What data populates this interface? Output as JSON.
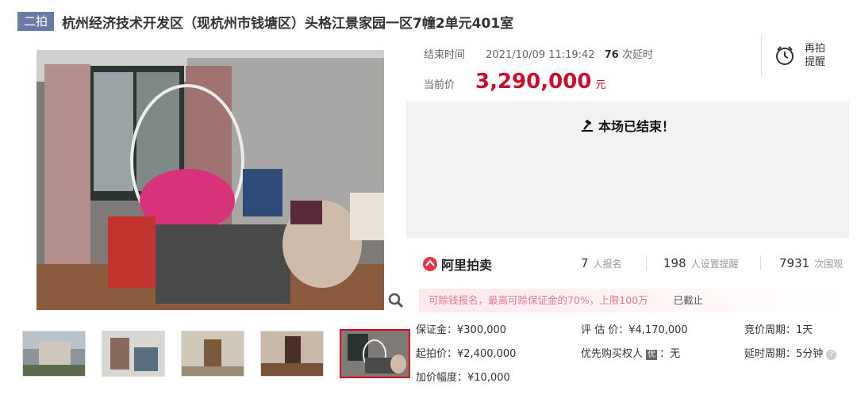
{
  "header": {
    "tag": "二拍",
    "title": "杭州经济技术开发区（现杭州市钱塘区）头格江景家园一区7幢2单元401室"
  },
  "auction": {
    "end_label": "结束时间",
    "end_time": "2021/10/09 11:19:42",
    "extend_count": "76",
    "extend_label": "次延时",
    "price_label": "当前价",
    "price": "3,290,000",
    "currency": "元",
    "remind": {
      "line1": "再拍",
      "line2": "提醒"
    },
    "ended_text": "本场已结束！"
  },
  "stats": {
    "logo_text": "阿里拍卖",
    "signups": {
      "num": "7",
      "label": "人报名"
    },
    "reminders": {
      "num": "198",
      "label": "人设置提醒"
    },
    "views": {
      "num": "7931",
      "label": "次围观"
    }
  },
  "notice": {
    "text": "可赊钱报名，最高可赊保证金的70%，上限100万",
    "status": "已截止"
  },
  "details": {
    "deposit": "保证金：¥300,000",
    "appraisal": "评 估 价：¥4,170,000",
    "cycle": "竞价周期：1天",
    "start_price": "起拍价：¥2,400,000",
    "priority_label": "优先购买权人",
    "priority_badge": "优",
    "priority_value": "：无",
    "delay": "延时周期：5分钟",
    "help": "?",
    "increment": "加价幅度：¥10,000"
  }
}
